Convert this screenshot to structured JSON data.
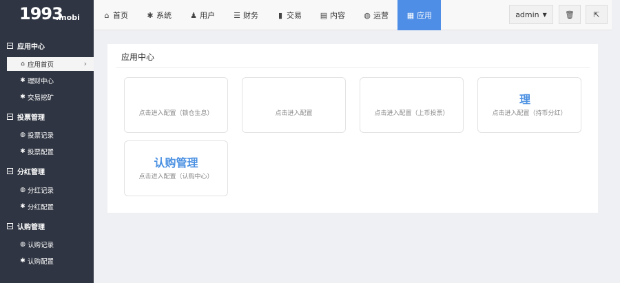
{
  "logo": {
    "main": "1993",
    "sub": ".mobi"
  },
  "nav": [
    {
      "icon": "home-icon",
      "glyph": "⌂",
      "label": "首页",
      "active": false
    },
    {
      "icon": "gear-icon",
      "glyph": "✱",
      "label": "系统",
      "active": false
    },
    {
      "icon": "user-icon",
      "glyph": "♟",
      "label": "用户",
      "active": false
    },
    {
      "icon": "list-icon",
      "glyph": "☰",
      "label": "财务",
      "active": false
    },
    {
      "icon": "bar-chart-icon",
      "glyph": "▮",
      "label": "交易",
      "active": false
    },
    {
      "icon": "document-icon",
      "glyph": "▤",
      "label": "内容",
      "active": false
    },
    {
      "icon": "globe-icon",
      "glyph": "◍",
      "label": "运营",
      "active": false
    },
    {
      "icon": "grid-icon",
      "glyph": "▦",
      "label": "应用",
      "active": true
    }
  ],
  "toolbar": {
    "user_label": "admin",
    "caret": "▼",
    "trash_glyph": "🗑",
    "logout_glyph": "⇱"
  },
  "sidebar": {
    "groups": [
      {
        "label": "应用中心",
        "items": [
          {
            "icon": "home-icon",
            "glyph": "⌂",
            "label": "应用首页",
            "active": true
          },
          {
            "icon": "gear-icon",
            "glyph": "✱",
            "label": "理财中心",
            "active": false
          },
          {
            "icon": "gear-icon",
            "glyph": "✱",
            "label": "交易挖矿",
            "active": false
          }
        ]
      },
      {
        "label": "投票管理",
        "items": [
          {
            "icon": "globe-icon",
            "glyph": "◍",
            "label": "投票记录",
            "active": false
          },
          {
            "icon": "gear-icon",
            "glyph": "✱",
            "label": "投票配置",
            "active": false
          }
        ]
      },
      {
        "label": "分红管理",
        "items": [
          {
            "icon": "globe-icon",
            "glyph": "◍",
            "label": "分红记录",
            "active": false
          },
          {
            "icon": "gear-icon",
            "glyph": "✱",
            "label": "分红配置",
            "active": false
          }
        ]
      },
      {
        "label": "认购管理",
        "items": [
          {
            "icon": "globe-icon",
            "glyph": "◍",
            "label": "认购记录",
            "active": false
          },
          {
            "icon": "gear-icon",
            "glyph": "✱",
            "label": "认购配置",
            "active": false
          }
        ]
      }
    ]
  },
  "main": {
    "title": "应用中心",
    "tiles": [
      {
        "name": "",
        "desc": "点击进入配置（锁仓生息）"
      },
      {
        "name": "",
        "desc": "点击进入配置"
      },
      {
        "name": "",
        "desc": "点击进入配置（上币投票）"
      },
      {
        "name": "理",
        "desc": "点击进入配置（持币分红）"
      },
      {
        "name": "认购管理",
        "desc": "点击进入配置（认购中心）"
      }
    ]
  }
}
